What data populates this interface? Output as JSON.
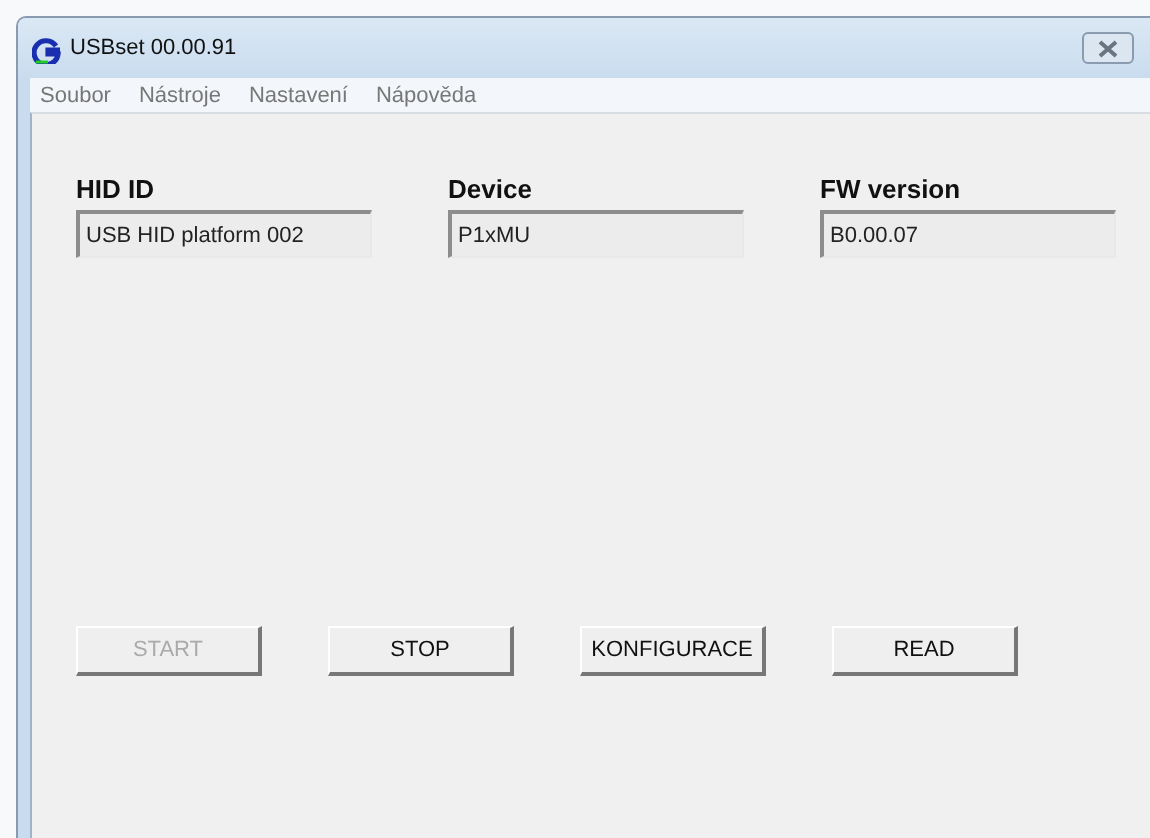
{
  "window": {
    "title": "USBset 00.00.91"
  },
  "menu": [
    "Soubor",
    "Nástroje",
    "Nastavení",
    "Nápověda"
  ],
  "fields": [
    {
      "label": "HID ID",
      "value": "USB HID platform 002"
    },
    {
      "label": "Device",
      "value": "P1xMU"
    },
    {
      "label": "FW version",
      "value": "B0.00.07"
    }
  ],
  "buttons": [
    {
      "label": "START",
      "disabled": true
    },
    {
      "label": "STOP",
      "disabled": false
    },
    {
      "label": "KONFIGURACE",
      "disabled": false
    },
    {
      "label": "READ",
      "disabled": false
    }
  ]
}
